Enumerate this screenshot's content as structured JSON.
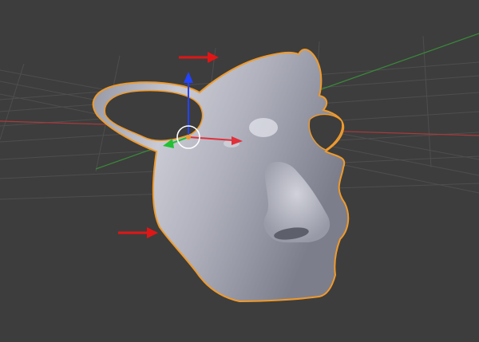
{
  "viewport": {
    "background": "#3d3d3d",
    "grid_color": "#4e4e4e",
    "x_axis_color": "#a83a3a",
    "y_axis_color": "#3a8a3a",
    "object_outline_color": "#f09a2a",
    "mesh_color": "#b9bac6",
    "annotation_arrow_color": "#e01616",
    "object": {
      "name": "face-mask-mesh",
      "selected": true
    },
    "transform_gizmo": {
      "mode": "translate",
      "axes": [
        "x",
        "y",
        "z"
      ],
      "colors": {
        "x": "#e0303a",
        "y": "#22c033",
        "z": "#2244ff"
      }
    },
    "annotation_arrows": [
      {
        "name": "top-arrow",
        "direction": "right"
      },
      {
        "name": "left-arrow",
        "direction": "right"
      }
    ]
  }
}
